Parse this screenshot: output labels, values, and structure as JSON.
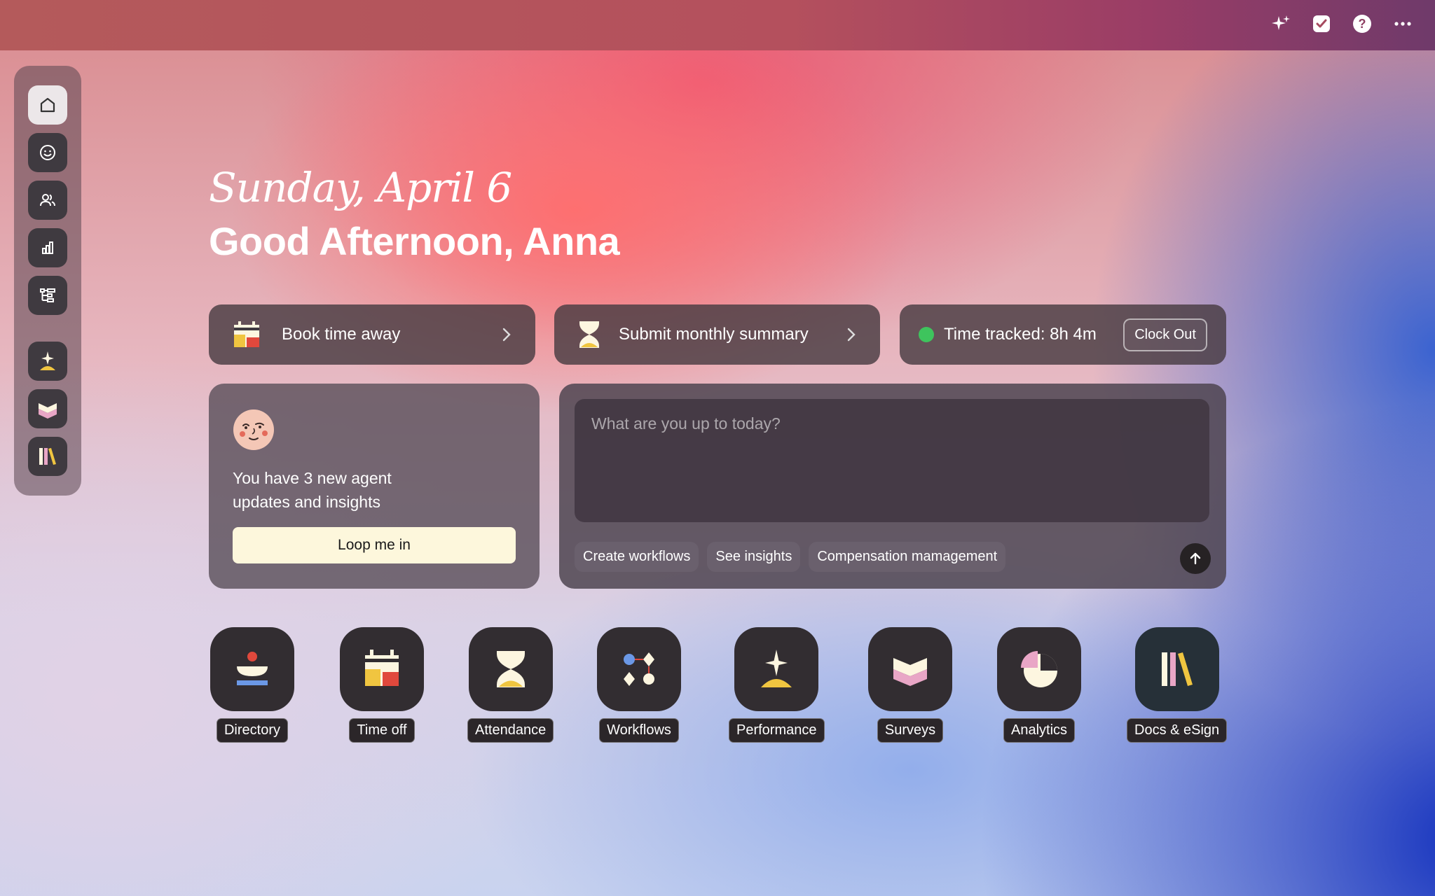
{
  "header": {
    "date": "Sunday, April 6",
    "greeting": "Good Afternoon, Anna"
  },
  "topbar": {
    "icons": [
      "sparkle-icon",
      "checkbox-icon",
      "help-icon",
      "more-icon"
    ]
  },
  "sidebar": {
    "items": [
      {
        "icon": "home-icon",
        "active": true
      },
      {
        "icon": "smiley-icon"
      },
      {
        "icon": "people-icon"
      },
      {
        "icon": "bar-chart-icon"
      },
      {
        "icon": "tree-icon"
      },
      {
        "icon": "performance-icon"
      },
      {
        "icon": "surveys-icon"
      },
      {
        "icon": "docs-icon"
      }
    ]
  },
  "actions": {
    "book_time_away": "Book time away",
    "submit_summary": "Submit monthly summary",
    "time_tracked": "Time tracked: 8h 4m",
    "clock_out": "Clock Out"
  },
  "agent": {
    "message": "You have 3 new agent updates and insights",
    "button": "Loop me in"
  },
  "chat": {
    "placeholder": "What are you up to today?",
    "chips": [
      "Create workflows",
      "See insights",
      "Compensation mamagement"
    ]
  },
  "apps": [
    {
      "label": "Directory"
    },
    {
      "label": "Time off"
    },
    {
      "label": "Attendance"
    },
    {
      "label": "Workflows"
    },
    {
      "label": "Performance"
    },
    {
      "label": "Surveys"
    },
    {
      "label": "Analytics"
    },
    {
      "label": "Docs & eSign"
    }
  ],
  "colors": {
    "status_green": "#3ec45d",
    "yellow": "#f0c540",
    "red": "#e0483c",
    "pink": "#e9a6c6",
    "blue": "#6b98e6"
  }
}
